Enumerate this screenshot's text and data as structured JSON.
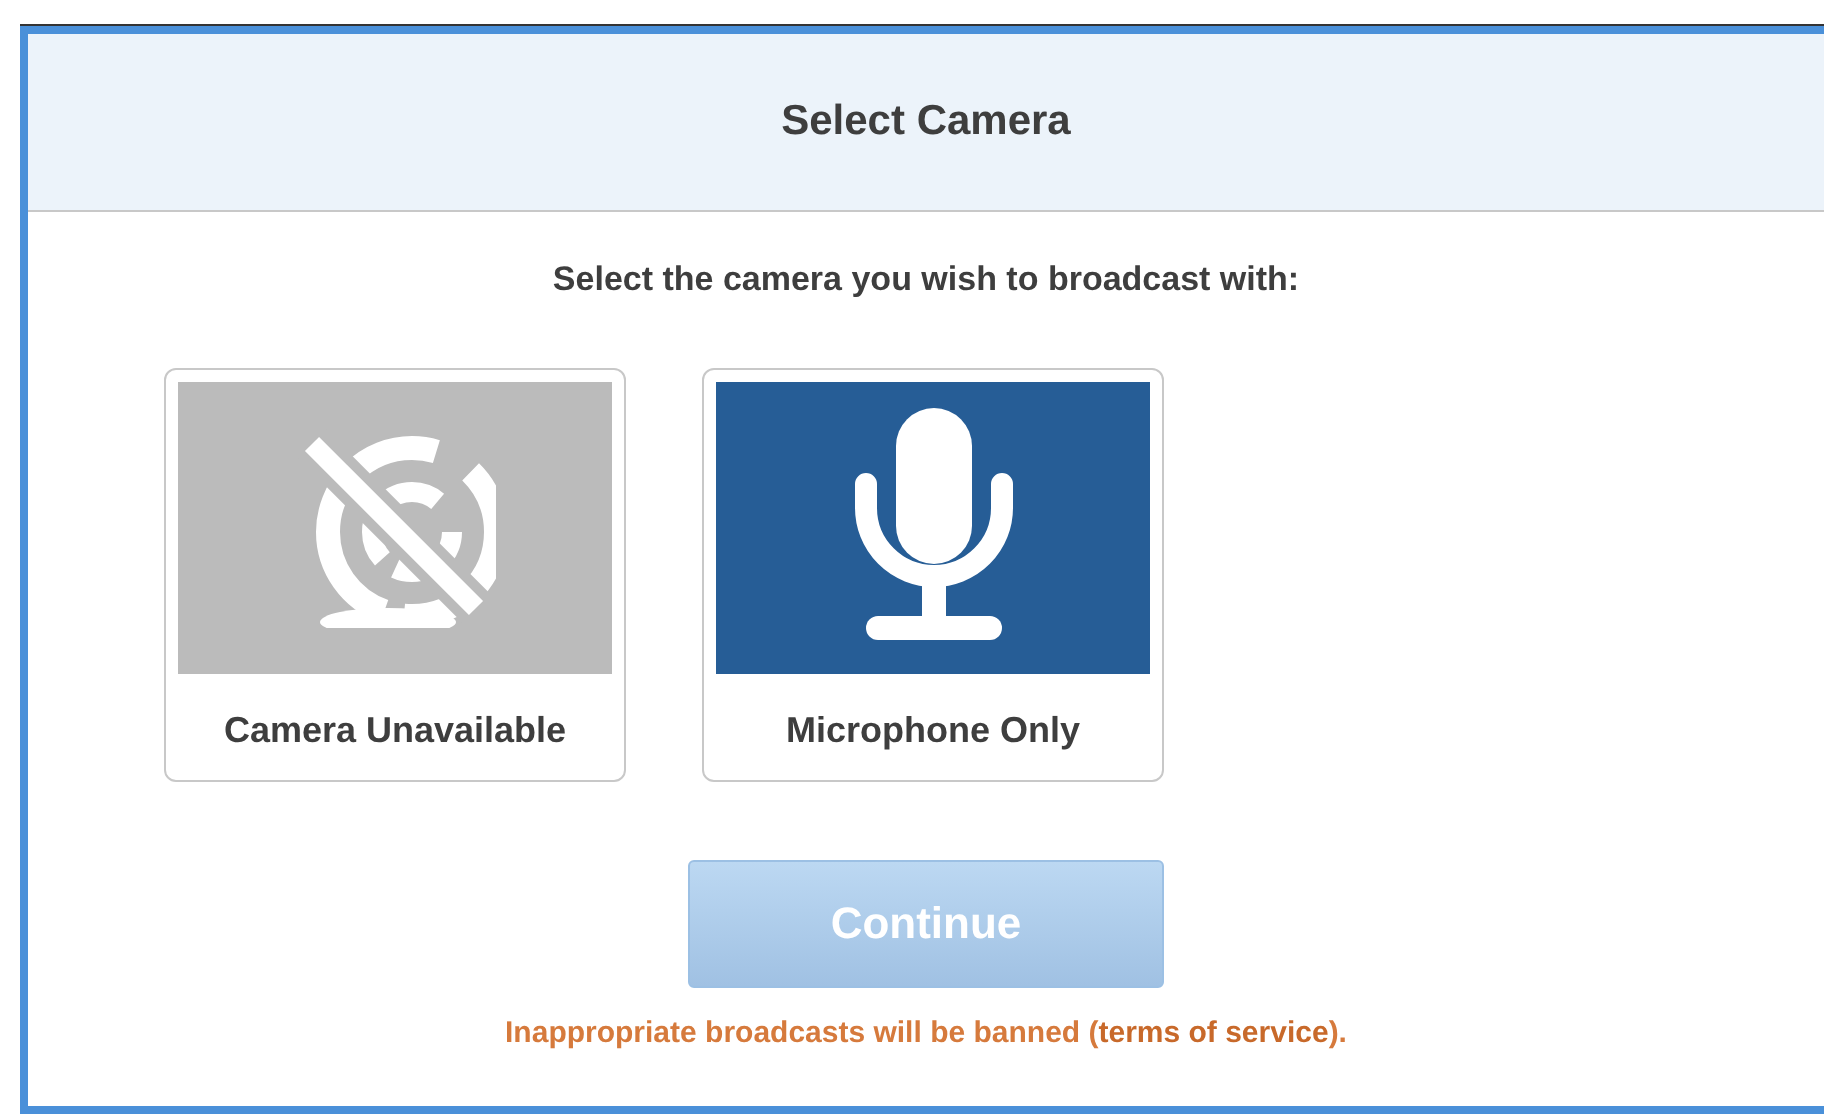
{
  "dialog": {
    "title": "Select Camera",
    "instruction": "Select the camera you wish to broadcast with:",
    "options": [
      {
        "label": "Camera Unavailable",
        "kind": "camera",
        "available": false
      },
      {
        "label": "Microphone Only",
        "kind": "microphone",
        "available": true
      }
    ],
    "continue_button": {
      "label": "Continue",
      "disabled": true
    },
    "notice": {
      "before": "Inappropriate broadcasts will be banned (",
      "link": "terms of service",
      "after": ")."
    }
  }
}
